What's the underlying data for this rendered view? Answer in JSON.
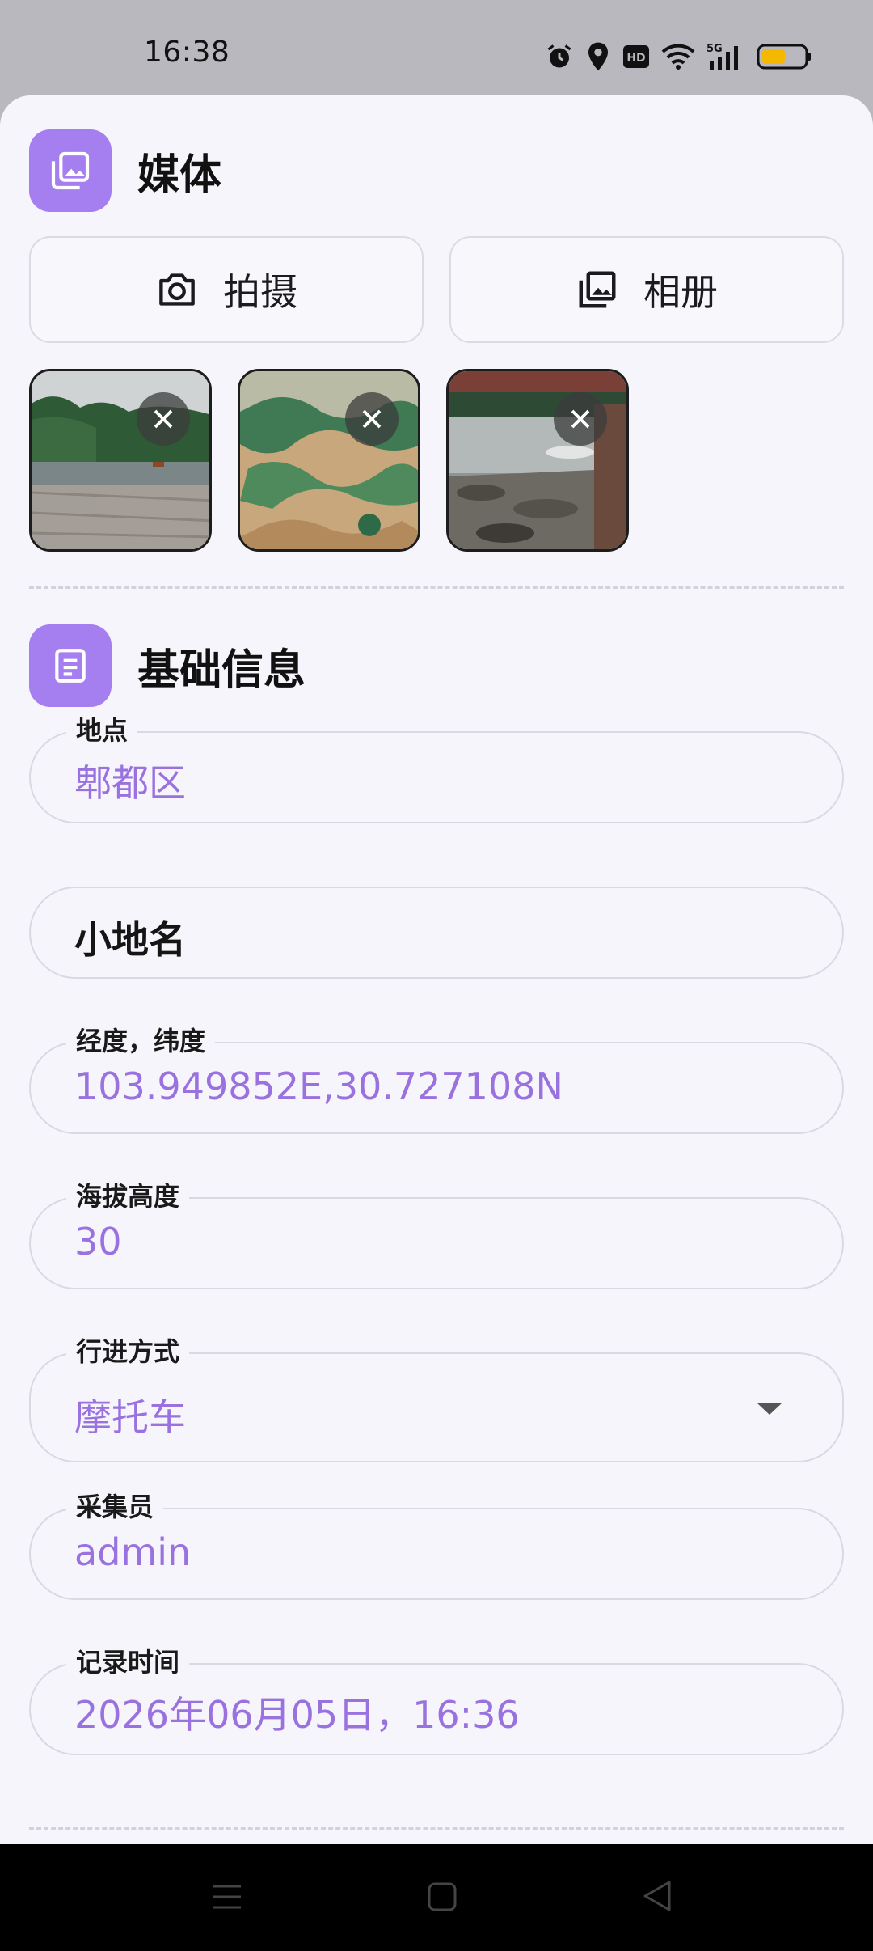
{
  "status_bar": {
    "time": "16:38",
    "icons": [
      "alarm-icon",
      "location-icon",
      "hd-icon",
      "wifi-icon",
      "5g-signal-icon",
      "battery-icon"
    ],
    "battery_color": "#f5b800"
  },
  "media_section": {
    "title": "媒体",
    "icon": "photo-library-icon",
    "camera_button_label": "拍摄",
    "album_button_label": "相册",
    "photos": [
      {
        "name": "river-bank-photo",
        "remove_icon": "close-icon"
      },
      {
        "name": "green-water-photo",
        "remove_icon": "close-icon"
      },
      {
        "name": "stream-rocks-photo",
        "remove_icon": "close-icon"
      }
    ]
  },
  "basic_info_section": {
    "title": "基础信息",
    "icon": "document-icon",
    "location": {
      "label": "地点",
      "value": "郫都区"
    },
    "small_place_name": {
      "placeholder": "小地名"
    },
    "coordinates": {
      "label": "经度，纬度",
      "value": "103.949852E,30.727108N"
    },
    "altitude": {
      "label": "海拔高度",
      "value": "30"
    },
    "travel_mode": {
      "label": "行进方式",
      "value": "摩托车"
    },
    "collector": {
      "label": "采集员",
      "value": "admin"
    },
    "record_time": {
      "label": "记录时间",
      "value": "2026年06月05日，16:36"
    }
  },
  "colors": {
    "accent": "#a57ef0",
    "value_text": "#9a72e0",
    "background": "#f6f5fb"
  },
  "nav_bar": {
    "icons": [
      "menu-icon",
      "home-icon",
      "back-icon"
    ]
  }
}
